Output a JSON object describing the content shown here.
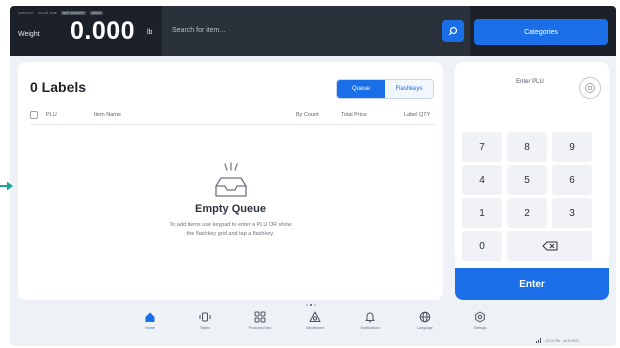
{
  "topbar": {
    "status_items": [
      "CAPACITY",
      "SCALE ONE",
      "NET WEIGHT",
      "ZERO"
    ],
    "weight_label": "Weight",
    "weight_value": "0.000",
    "weight_unit": "lb",
    "search_placeholder": "Search for item...",
    "categories_label": "Categories"
  },
  "labels": {
    "title": "0 Labels",
    "tabs": [
      {
        "label": "Queue",
        "active": true
      },
      {
        "label": "Flashkeys",
        "active": false
      }
    ],
    "columns": [
      "PLU",
      "Item Name",
      "By Count",
      "Total Price",
      "Label QTY"
    ],
    "empty_title": "Empty Queue",
    "empty_description": "To add items use keypad to enter a PLU OR show the flashkey grid and tap a flashkey."
  },
  "keypad": {
    "plu_label": "Enter PLU",
    "keys": [
      "7",
      "8",
      "9",
      "4",
      "5",
      "6",
      "1",
      "2",
      "3",
      "0"
    ],
    "enter_label": "Enter"
  },
  "nav": {
    "items": [
      {
        "label": "Home",
        "icon": "home-icon",
        "active": true
      },
      {
        "label": "Tables",
        "icon": "tables-icon",
        "active": false
      },
      {
        "label": "Products Entry",
        "icon": "products-grid-icon",
        "active": false
      },
      {
        "label": "Department",
        "icon": "department-icon",
        "active": false
      },
      {
        "label": "Notifications",
        "icon": "bell-icon",
        "active": false
      },
      {
        "label": "Language",
        "icon": "globe-icon",
        "active": false
      },
      {
        "label": "Settings",
        "icon": "settings-icon",
        "active": false
      }
    ]
  },
  "system": {
    "time": "12:11 PM",
    "date": "Jul 5 2022"
  },
  "colors": {
    "accent": "#1a6fe8",
    "topbar": "#1c2129",
    "background": "#eef1f5",
    "arrow": "#1aa39a"
  }
}
